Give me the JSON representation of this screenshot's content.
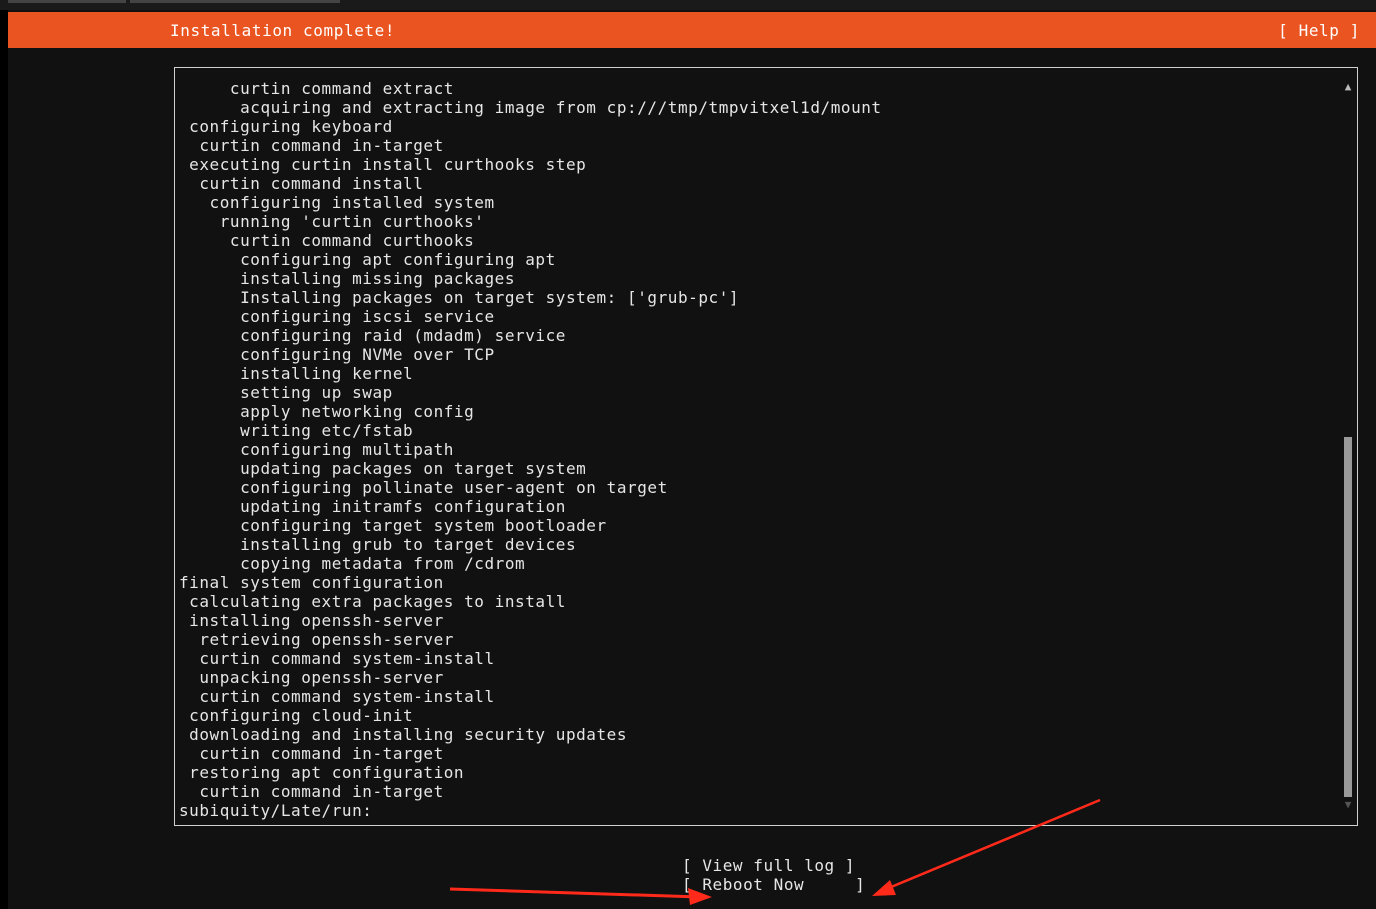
{
  "header": {
    "title": "Installation complete!",
    "help_label": "[ Help ]"
  },
  "log": {
    "lines": [
      "     curtin command extract",
      "      acquiring and extracting image from cp:///tmp/tmpvitxel1d/mount",
      " configuring keyboard",
      "  curtin command in-target",
      " executing curtin install curthooks step",
      "  curtin command install",
      "   configuring installed system",
      "    running 'curtin curthooks'",
      "     curtin command curthooks",
      "      configuring apt configuring apt",
      "      installing missing packages",
      "      Installing packages on target system: ['grub-pc']",
      "      configuring iscsi service",
      "      configuring raid (mdadm) service",
      "      configuring NVMe over TCP",
      "      installing kernel",
      "      setting up swap",
      "      apply networking config",
      "      writing etc/fstab",
      "      configuring multipath",
      "      updating packages on target system",
      "      configuring pollinate user-agent on target",
      "      updating initramfs configuration",
      "      configuring target system bootloader",
      "      installing grub to target devices",
      "      copying metadata from /cdrom",
      "final system configuration",
      " calculating extra packages to install",
      " installing openssh-server",
      "  retrieving openssh-server",
      "  curtin command system-install",
      "  unpacking openssh-server",
      "  curtin command system-install",
      " configuring cloud-init",
      " downloading and installing security updates",
      "  curtin command in-target",
      " restoring apt configuration",
      "  curtin command in-target",
      "subiquity/Late/run:"
    ]
  },
  "scrollbar": {
    "up_icon": "▲",
    "down_icon": "▼"
  },
  "buttons": {
    "view_full_log": "[ View full log ]",
    "reboot_now": "[ Reboot Now     ]"
  },
  "colors": {
    "header_bg": "#e95420",
    "annotation_arrow": "#ff2a1a"
  }
}
